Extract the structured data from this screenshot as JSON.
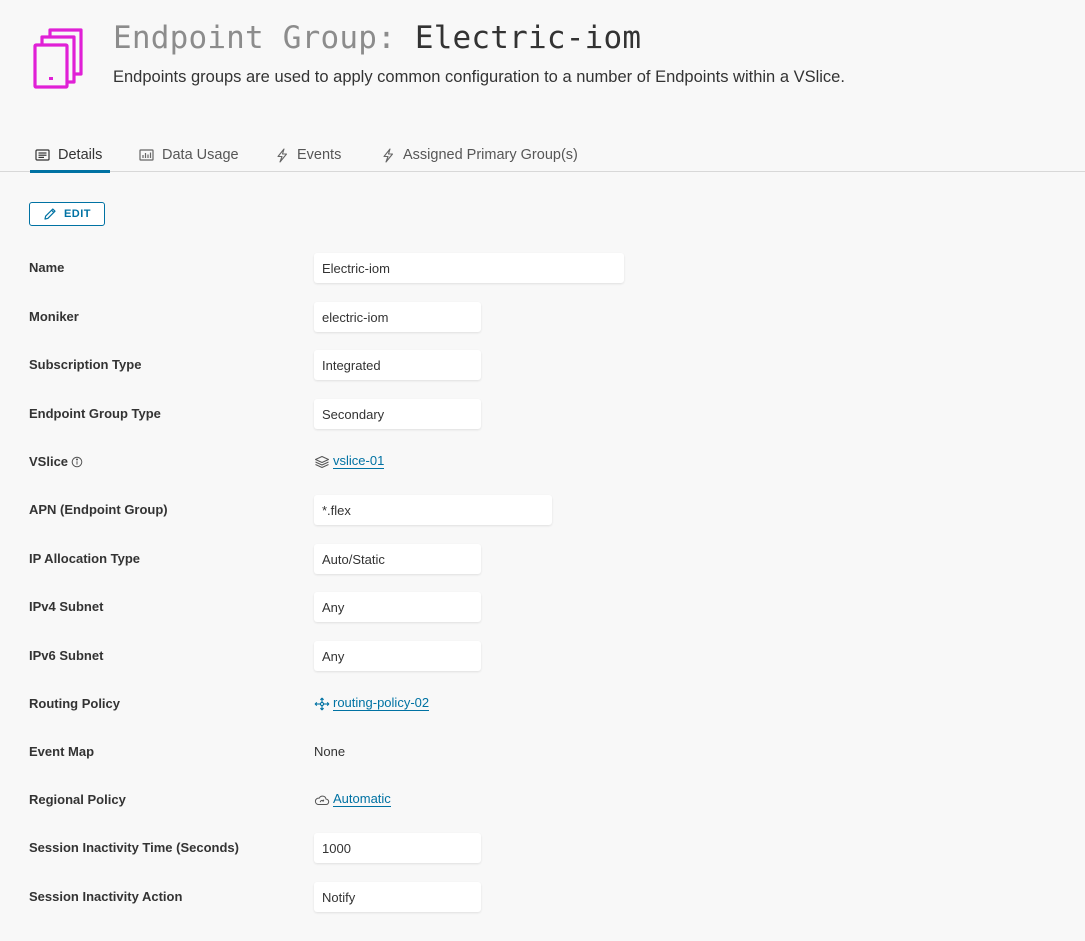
{
  "header": {
    "title_prefix": "Endpoint Group: ",
    "title_name": "Electric-iom",
    "subtitle": "Endpoints groups are used to apply common configuration to a number of Endpoints within a VSlice.",
    "icon": "endpoint-group-icon",
    "icon_color": "#e020d6"
  },
  "tabs": [
    {
      "label": "Details",
      "icon": "details-icon",
      "active": true
    },
    {
      "label": "Data Usage",
      "icon": "chart-icon",
      "active": false
    },
    {
      "label": "Events",
      "icon": "lightning-icon",
      "active": false
    },
    {
      "label": "Assigned Primary Group(s)",
      "icon": "lightning-icon",
      "active": false
    }
  ],
  "edit_button": {
    "label": "EDIT",
    "icon": "pencil-icon"
  },
  "fields": {
    "name": {
      "label": "Name",
      "value": "Electric-iom"
    },
    "moniker": {
      "label": "Moniker",
      "value": "electric-iom"
    },
    "subscription_type": {
      "label": "Subscription Type",
      "value": "Integrated"
    },
    "endpoint_group_type": {
      "label": "Endpoint Group Type",
      "value": "Secondary"
    },
    "vslice": {
      "label": "VSlice",
      "value": "vslice-01",
      "icon": "layers-icon",
      "info_icon": "info-icon"
    },
    "apn": {
      "label": "APN (Endpoint Group)",
      "value": "*.flex"
    },
    "ip_allocation_type": {
      "label": "IP Allocation Type",
      "value": "Auto/Static"
    },
    "ipv4_subnet": {
      "label": "IPv4 Subnet",
      "value": "Any"
    },
    "ipv6_subnet": {
      "label": "IPv6 Subnet",
      "value": "Any"
    },
    "routing_policy": {
      "label": "Routing Policy",
      "value": "routing-policy-02",
      "icon": "routing-icon"
    },
    "event_map": {
      "label": "Event Map",
      "value": "None"
    },
    "regional_policy": {
      "label": "Regional Policy",
      "value": "Automatic",
      "icon": "cloud-icon"
    },
    "session_inactivity_time": {
      "label": "Session Inactivity Time (Seconds)",
      "value": "1000"
    },
    "session_inactivity_action": {
      "label": "Session Inactivity Action",
      "value": "Notify"
    }
  },
  "colors": {
    "accent": "#0072a3",
    "brand_icon": "#e020d6",
    "background": "#f8f8f8"
  }
}
